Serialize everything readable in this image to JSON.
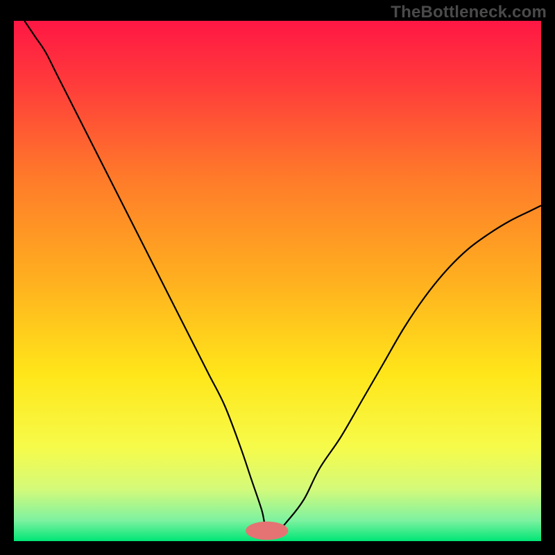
{
  "watermark": "TheBottleneck.com",
  "chart_data": {
    "type": "line",
    "title": "",
    "xlabel": "",
    "ylabel": "",
    "xlim": [
      0,
      100
    ],
    "ylim": [
      0,
      100
    ],
    "grid": false,
    "legend": false,
    "background": {
      "type": "vertical-gradient",
      "stops": [
        {
          "offset": 0.0,
          "color": "#ff1744"
        },
        {
          "offset": 0.12,
          "color": "#ff3b3b"
        },
        {
          "offset": 0.3,
          "color": "#ff7a2a"
        },
        {
          "offset": 0.5,
          "color": "#ffb01f"
        },
        {
          "offset": 0.68,
          "color": "#ffe61a"
        },
        {
          "offset": 0.82,
          "color": "#f6fb4a"
        },
        {
          "offset": 0.9,
          "color": "#d4fa7a"
        },
        {
          "offset": 0.96,
          "color": "#7ef2a0"
        },
        {
          "offset": 1.0,
          "color": "#00e676"
        }
      ]
    },
    "marker": {
      "x": 48,
      "y": 2,
      "color": "#e57373",
      "rx": 7,
      "ry": 3
    },
    "series": [
      {
        "name": "bottleneck-curve",
        "color": "#000000",
        "width": 2.2,
        "x": [
          2,
          4,
          6,
          8,
          10,
          13,
          16,
          19,
          22,
          25,
          28,
          31,
          34,
          37,
          40,
          43,
          45,
          47,
          48,
          50,
          52,
          55,
          58,
          62,
          66,
          70,
          74,
          78,
          82,
          86,
          90,
          94,
          98,
          100
        ],
        "y": [
          100,
          97,
          94,
          90,
          86,
          80,
          74,
          68,
          62,
          56,
          50,
          44,
          38,
          32,
          26,
          18,
          12,
          6,
          2,
          2,
          4,
          8,
          14,
          20,
          27,
          34,
          41,
          47,
          52,
          56,
          59,
          61.5,
          63.5,
          64.5
        ]
      }
    ]
  }
}
